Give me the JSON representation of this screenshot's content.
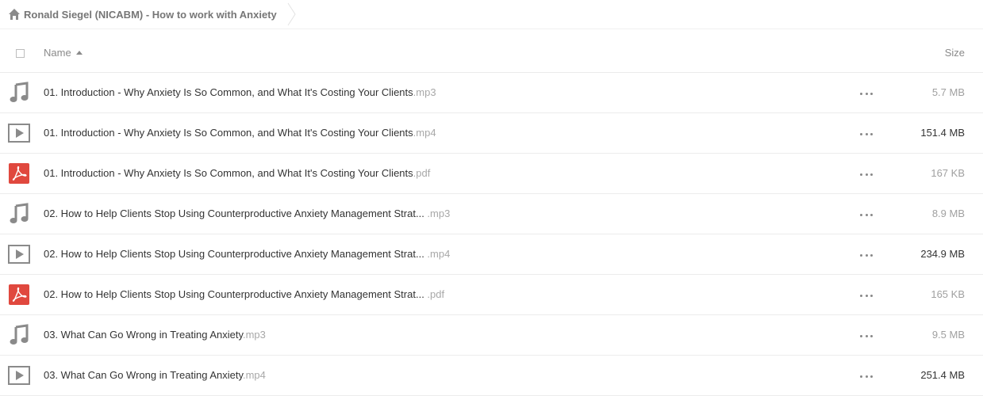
{
  "breadcrumb": {
    "path": "Ronald Siegel (NICABM) - How to work with Anxiety"
  },
  "header": {
    "name_label": "Name",
    "size_label": "Size"
  },
  "colors": {
    "audio_icon": "#8a8a8a",
    "video_icon": "#8a8a8a",
    "pdf_icon": "#e0483e",
    "size_dim": "#a0a0a0",
    "size_strong": "#333333"
  },
  "files": [
    {
      "name": "01. Introduction - Why Anxiety Is So Common, and What It's Costing Your Clients",
      "ext": ".mp3",
      "type": "audio-icon",
      "size": "5.7 MB",
      "size_strong": false
    },
    {
      "name": "01. Introduction - Why Anxiety Is So Common, and What It's Costing Your Clients",
      "ext": ".mp4",
      "type": "video-icon",
      "size": "151.4 MB",
      "size_strong": true
    },
    {
      "name": "01. Introduction - Why Anxiety Is So Common, and What It's Costing Your Clients",
      "ext": ".pdf",
      "type": "pdf-icon",
      "size": "167 KB",
      "size_strong": false
    },
    {
      "name": "02. How to Help Clients Stop Using Counterproductive Anxiety Management Strat...",
      "ext": " .mp3",
      "type": "audio-icon",
      "size": "8.9 MB",
      "size_strong": false
    },
    {
      "name": "02. How to Help Clients Stop Using Counterproductive Anxiety Management Strat...",
      "ext": " .mp4",
      "type": "video-icon",
      "size": "234.9 MB",
      "size_strong": true
    },
    {
      "name": "02. How to Help Clients Stop Using Counterproductive Anxiety Management Strat...",
      "ext": " .pdf",
      "type": "pdf-icon",
      "size": "165 KB",
      "size_strong": false
    },
    {
      "name": "03. What Can Go Wrong in Treating Anxiety",
      "ext": ".mp3",
      "type": "audio-icon",
      "size": "9.5 MB",
      "size_strong": false
    },
    {
      "name": "03. What Can Go Wrong in Treating Anxiety",
      "ext": ".mp4",
      "type": "video-icon",
      "size": "251.4 MB",
      "size_strong": true
    }
  ]
}
